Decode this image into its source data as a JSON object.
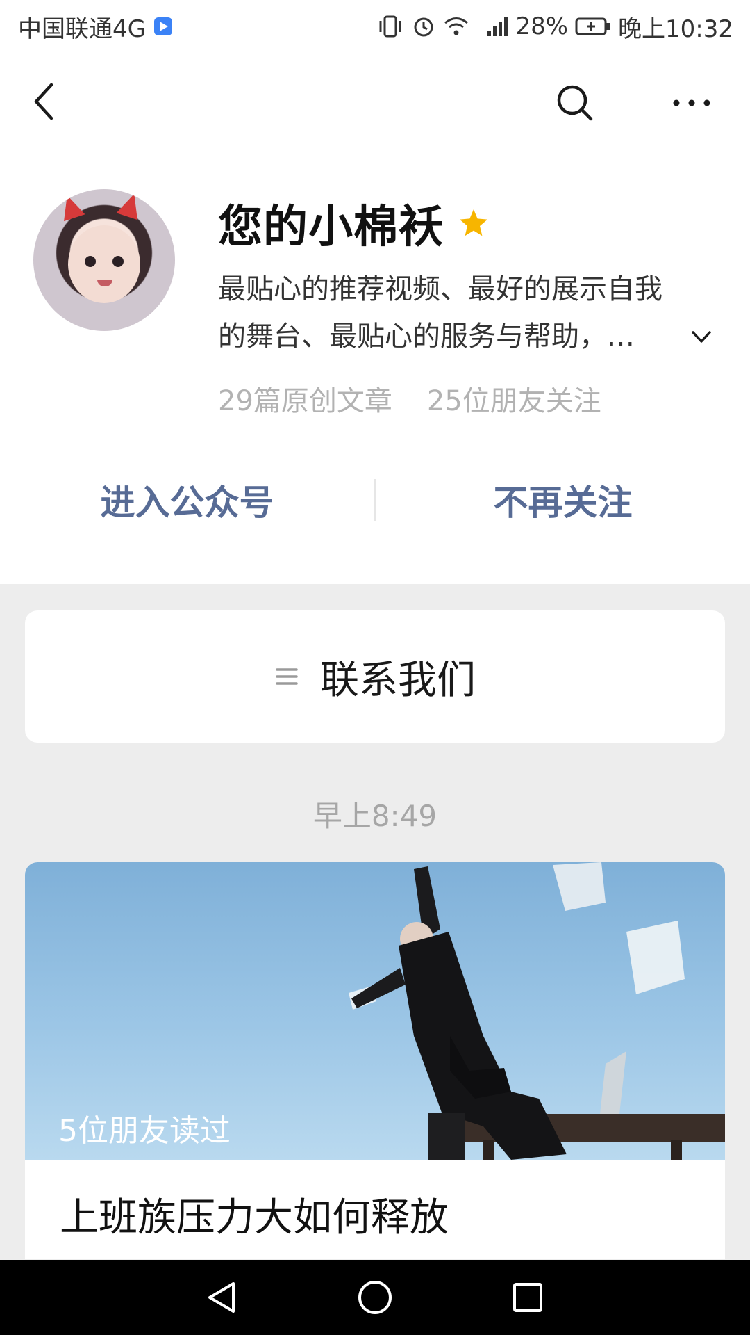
{
  "status_bar": {
    "carrier": "中国联通4G",
    "battery": "28%",
    "time": "晚上10:32",
    "icons": [
      "vibrate-icon",
      "alarm-icon",
      "wifi-icon",
      "signal-4g-icon",
      "battery-charging-icon"
    ]
  },
  "nav": {
    "icons": [
      "back-chevron-icon",
      "search-icon",
      "more-dots-icon"
    ]
  },
  "profile": {
    "name": "您的小棉袄",
    "verified_icon": "star-icon",
    "description_line1": "最贴心的推荐视频、最好的展示自我",
    "description_line2": "的舞台、最贴心的服务与帮助，…",
    "articles": "29篇原创文章",
    "followers": "25位朋友关注",
    "enter_button": "进入公众号",
    "unfollow_button": "不再关注"
  },
  "menu": {
    "label": "联系我们",
    "icon": "menu-lines-icon"
  },
  "feed": {
    "timestamp": "早上8:49",
    "article": {
      "read_by": "5位朋友读过",
      "title": "上班族压力大如何释放"
    }
  },
  "system_nav": {
    "icons": [
      "nav-back-triangle-icon",
      "nav-home-circle-icon",
      "nav-recents-square-icon"
    ]
  },
  "colors": {
    "link_blue": "#576b95",
    "background": "#ededed",
    "star": "#f7b500"
  }
}
